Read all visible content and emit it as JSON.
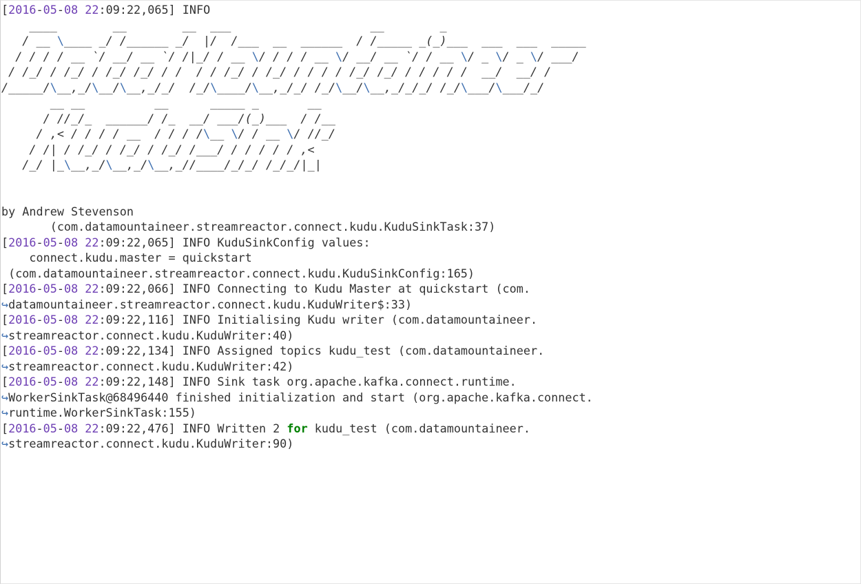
{
  "log": {
    "lines": [
      "[2016-05-08 22:09:22,065] INFO",
      "    ____        __        __  ___                    __        _",
      "   / __ \\____ _/ /______ _/  |/  /___  __  ______  / /_____ _(_)___  ___  ___  _____",
      "  / / / / __ `/ __/ __ `/ /|_/ / __ \\/ / / / __ \\/ __/ __ `/ / __ \\/ _ \\/ _ \\/ ___/",
      " / /_/ / /_/ / /_/ /_/ / /  / / /_/ / /_/ / / / / /_/ /_/ / / / / /  __/  __/ /",
      "/_____/\\__,_/\\__/\\__,_/_/  /_/\\____/\\__,_/_/ /_/\\__/\\__,_/_/_/ /_/\\___/\\___/_/",
      "       __ __          __      _____ _       __",
      "      / //_/_  ______/ /_  __/ ___/(_)___  / /__",
      "     / ,< / / / / __  / / / /\\__ \\/ / __ \\/ //_/",
      "    / /| / /_/ / /_/ / /_/ /___/ / / / / / ,<",
      "   /_/ |_\\__,_/\\__,_/\\__,_//____/_/_/ /_/_/|_|",
      "",
      "",
      "by Andrew Stevenson",
      "       (com.datamountaineer.streamreactor.connect.kudu.KuduSinkTask:37)",
      "[2016-05-08 22:09:22,065] INFO KuduSinkConfig values:",
      "    connect.kudu.master = quickstart",
      " (com.datamountaineer.streamreactor.connect.kudu.KuduSinkConfig:165)",
      "[2016-05-08 22:09:22,066] INFO Connecting to Kudu Master at quickstart (com.",
      "↪datamountaineer.streamreactor.connect.kudu.KuduWriter$:33)",
      "[2016-05-08 22:09:22,116] INFO Initialising Kudu writer (com.datamountaineer.",
      "↪streamreactor.connect.kudu.KuduWriter:40)",
      "[2016-05-08 22:09:22,134] INFO Assigned topics kudu_test (com.datamountaineer.",
      "↪streamreactor.connect.kudu.KuduWriter:42)",
      "[2016-05-08 22:09:22,148] INFO Sink task org.apache.kafka.connect.runtime.",
      "↪WorkerSinkTask@68496440 finished initialization and start (org.apache.kafka.connect.",
      "↪runtime.WorkerSinkTask:155)",
      "[2016-05-08 22:09:22,476] INFO Written 2 for kudu_test (com.datamountaineer.",
      "↪streamreactor.connect.kudu.KuduWriter:90)"
    ]
  },
  "colors": {
    "text": "#333333",
    "number": "#6e3fb4",
    "escape": "#3e6fb0",
    "keyword": "#008000",
    "continuation_arrow": "#3e6fb0"
  }
}
